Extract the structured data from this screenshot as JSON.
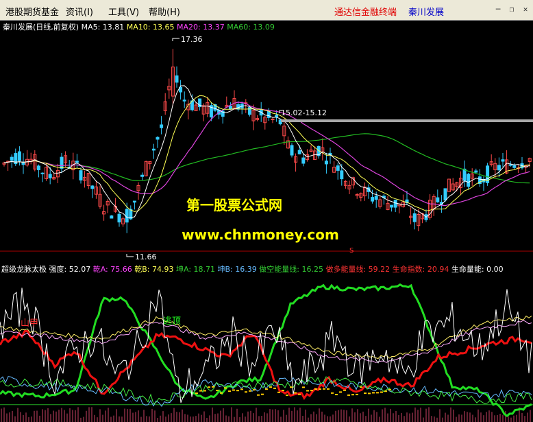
{
  "menu": {
    "items": [
      "港股期货基金",
      "资讯(I)",
      "工具(V)",
      "帮助(H)"
    ],
    "brand_left": "通达信金融终端",
    "brand_right": "秦川发展",
    "brand_left_color": "#e00000",
    "brand_right_color": "#0000c8",
    "window_buttons": [
      "minimize-icon",
      "restore-icon",
      "close-icon"
    ]
  },
  "main_header": {
    "name": "秦川发展(日线,前复权)",
    "ma": [
      {
        "label": "MA5:",
        "value": "13.81",
        "color": "#ffffff"
      },
      {
        "label": "MA10:",
        "value": "13.65",
        "color": "#ffff55"
      },
      {
        "label": "MA20:",
        "value": "13.37",
        "color": "#ff44ff"
      },
      {
        "label": "MA60:",
        "value": "13.09",
        "color": "#33cc33"
      }
    ]
  },
  "price_marks": {
    "high": "17.36",
    "low": "11.66",
    "range": "15.02-15.12"
  },
  "watermark": {
    "line1": "第一股票公式网",
    "line2": "www.chnmoney.com",
    "color": "#ffff00"
  },
  "indicator_header": {
    "name": "超级龙脉太极",
    "items": [
      {
        "label": "强度:",
        "value": "52.07",
        "color": "#ffffff"
      },
      {
        "label": "乾A:",
        "value": "75.66",
        "color": "#ff44ff"
      },
      {
        "label": "乾B:",
        "value": "74.93",
        "color": "#ffff55"
      },
      {
        "label": "坤A:",
        "value": "18.71",
        "color": "#33cc33"
      },
      {
        "label": "坤B:",
        "value": "16.39",
        "color": "#66bbff"
      },
      {
        "label": "做空能量线:",
        "value": "16.25",
        "color": "#33cc33"
      },
      {
        "label": "做多能量线:",
        "value": "59.22",
        "color": "#ff3333"
      },
      {
        "label": "生命指数:",
        "value": "20.94",
        "color": "#ff3333"
      },
      {
        "label": "生命量能:",
        "value": "0.00",
        "color": "#ffffff"
      }
    ]
  },
  "annotations": {
    "left": "山甲",
    "right": "逃顶",
    "marker": "S"
  },
  "colors": {
    "up": "#ff4a4a",
    "down": "#33ccff",
    "ma5": "#ffffff",
    "ma10": "#ffff55",
    "ma20": "#dd44dd",
    "ma60": "#22bb22",
    "separator": "#aa0000"
  }
}
